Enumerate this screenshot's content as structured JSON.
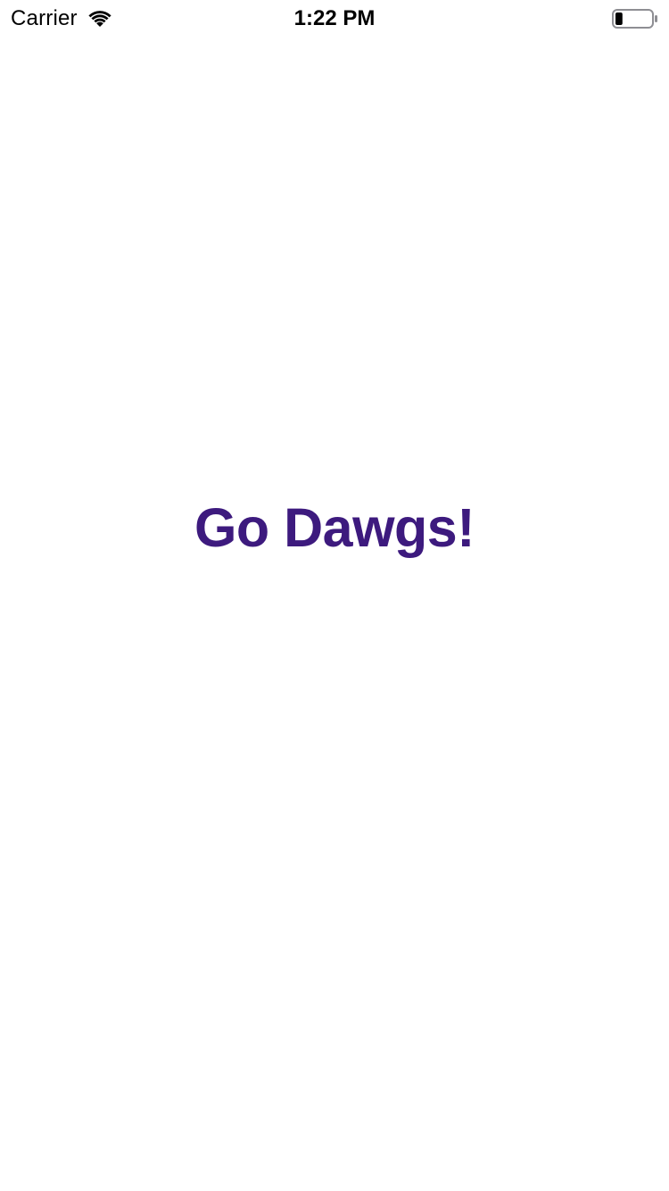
{
  "status_bar": {
    "carrier": "Carrier",
    "time": "1:22 PM",
    "wifi_icon": "wifi-icon",
    "battery_icon": "battery-icon",
    "battery_level_fraction": 0.2
  },
  "main": {
    "label": "Go Dawgs!",
    "label_color": "#3d1a7e"
  }
}
